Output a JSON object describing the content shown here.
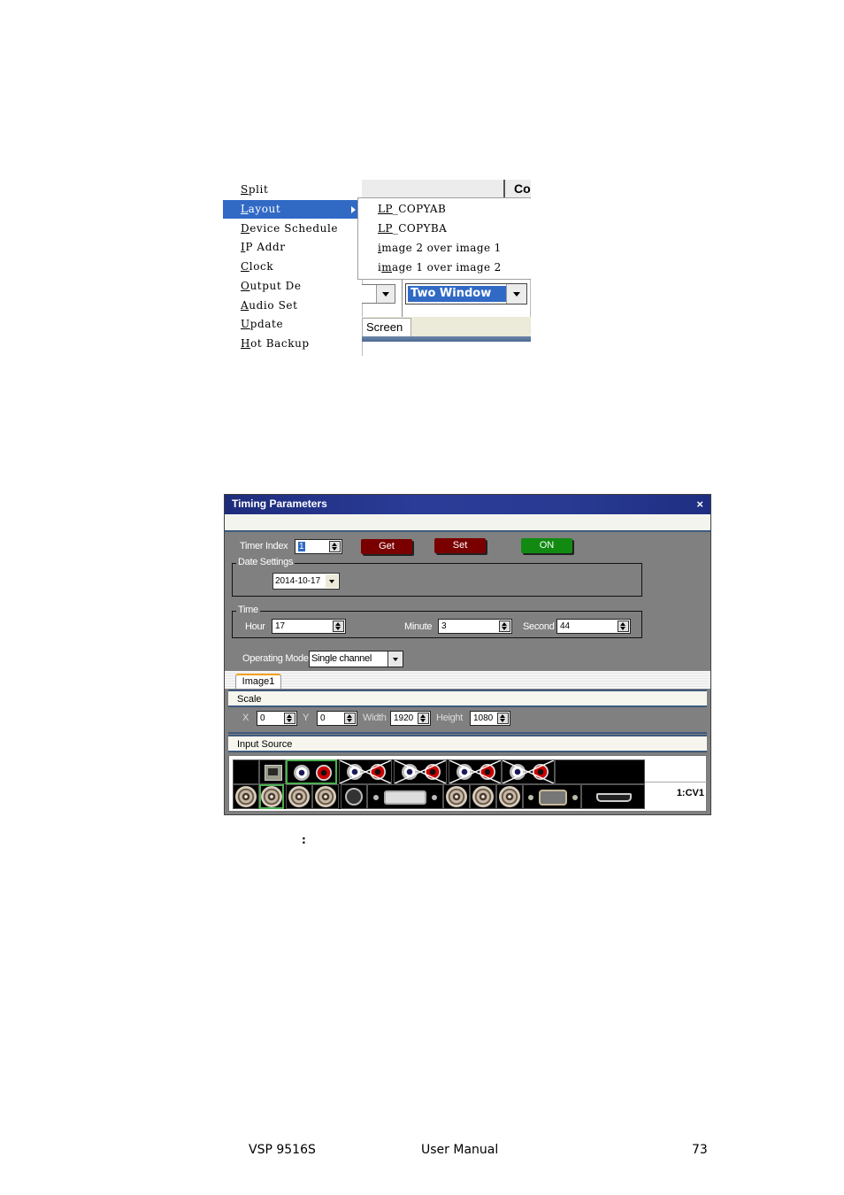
{
  "menu_screenshot": {
    "menu_items": [
      {
        "label": "Split",
        "mnemonic": "S",
        "rest": "plit",
        "active": false
      },
      {
        "label": "Layout",
        "mnemonic": "L",
        "rest": "ayout",
        "active": true,
        "has_submenu": true
      },
      {
        "label": "Device Schedule",
        "mnemonic": "D",
        "rest": "evice Schedule",
        "active": false
      },
      {
        "label": "IP Addr",
        "mnemonic": "I",
        "rest": "P Addr",
        "active": false
      },
      {
        "label": "Clock",
        "mnemonic": "C",
        "rest": "lock",
        "active": false
      },
      {
        "label": "Output De",
        "mnemonic": "O",
        "rest": "utput De",
        "active": false
      },
      {
        "label": "Audio Set",
        "mnemonic": "A",
        "rest": "udio Set",
        "active": false
      },
      {
        "label": "Update",
        "mnemonic": "U",
        "rest": "pdate",
        "active": false
      },
      {
        "label": "Hot Backup",
        "mnemonic": "H",
        "rest": "ot Backup",
        "active": false
      }
    ],
    "submenu_items": [
      {
        "pre": "",
        "mnemonic": "LP",
        "rest": "_COPYAB"
      },
      {
        "pre": "",
        "mnemonic": "LP",
        "rest": "_COPYBA"
      },
      {
        "pre": "",
        "mnemonic": "i",
        "rest": "mage 2 over image 1"
      },
      {
        "pre": "i",
        "mnemonic": "m",
        "rest": "age 1 over image 2"
      }
    ],
    "background": {
      "column_header": "Co",
      "window_mode_value": "Two Window",
      "tab_label": "Screen"
    }
  },
  "timing_dialog": {
    "title": "Timing Parameters",
    "close_glyph": "×",
    "timer_index_label": "Timer Index",
    "timer_index_value": "1",
    "get_label": "Get",
    "set_label": "Set",
    "on_label": "ON",
    "date_group_label": "Date Settings",
    "date_value": "2014-10-17",
    "time_group_label": "Time",
    "hour_label": "Hour",
    "hour_value": "17",
    "minute_label": "Minute",
    "minute_value": "3",
    "second_label": "Second",
    "second_value": "44",
    "operating_mode_label": "Operating Mode",
    "operating_mode_value": "Single channel",
    "image_tab_label": "Image1",
    "scale_header": "Scale",
    "x_label": "X",
    "x_value": "0",
    "y_label": "Y",
    "y_value": "0",
    "width_label": "Width",
    "width_value": "1920",
    "height_label": "Height",
    "height_value": "1080",
    "input_source_header": "Input Source",
    "selected_source": "1:CV1",
    "input_ports_row1": [
      "empty",
      "ethernet",
      "rca-pair-selected",
      "rca-pair-disabled",
      "rca-pair-disabled",
      "rca-pair-disabled",
      "rca-pair-disabled",
      "empty"
    ],
    "input_ports_row2": [
      "bnc",
      "bnc-selected",
      "bnc",
      "bnc",
      "s-video",
      "dvi",
      "bnc",
      "bnc",
      "bnc",
      "vga",
      "displayport"
    ]
  },
  "caption_fragment": ":",
  "footer": {
    "product": "VSP 9516S",
    "title": "User Manual",
    "page_number": "73"
  }
}
